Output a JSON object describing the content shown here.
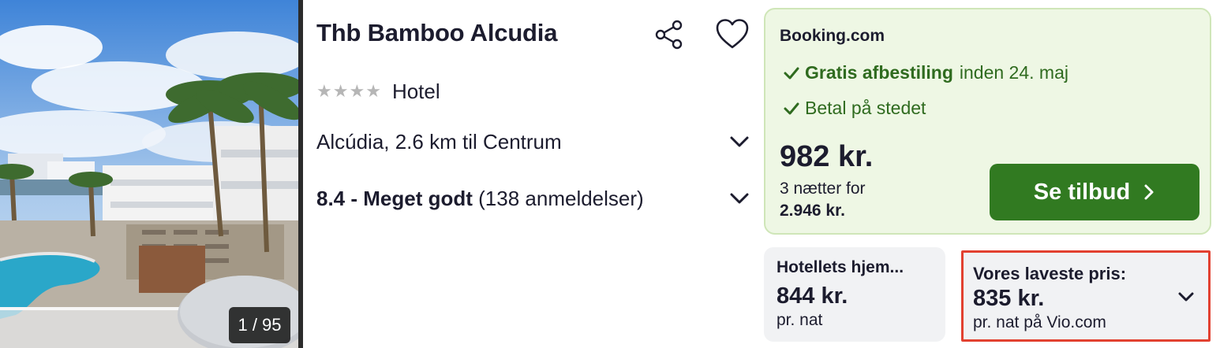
{
  "photo": {
    "counter": "1 / 95"
  },
  "hotel": {
    "name": "Thb Bamboo Alcudia",
    "stars": 4,
    "type": "Hotel",
    "location": "Alcúdia, 2.6 km til Centrum",
    "rating_score": "8.4 - Meget godt",
    "rating_count": "(138 anmeldelser)"
  },
  "offer": {
    "provider": "Booking.com",
    "perk1_bold": "Gratis afbestiling",
    "perk1_rest": "inden 24. maj",
    "perk2": "Betal på stedet",
    "price": "982 kr.",
    "nights_text": "3 nætter for",
    "total": "2.946 kr.",
    "cta": "Se tilbud"
  },
  "alt_offers": [
    {
      "label": "Hotellets hjem...",
      "price": "844 kr.",
      "sub": "pr. nat"
    },
    {
      "label": "Vores laveste pris:",
      "price": "835 kr.",
      "sub": "pr. nat på Vio.com"
    }
  ],
  "colors": {
    "offer_bg": "#eef7e4",
    "cta_bg": "#317a21",
    "perk_green": "#2f6b1f",
    "highlight_border": "#e24130"
  }
}
